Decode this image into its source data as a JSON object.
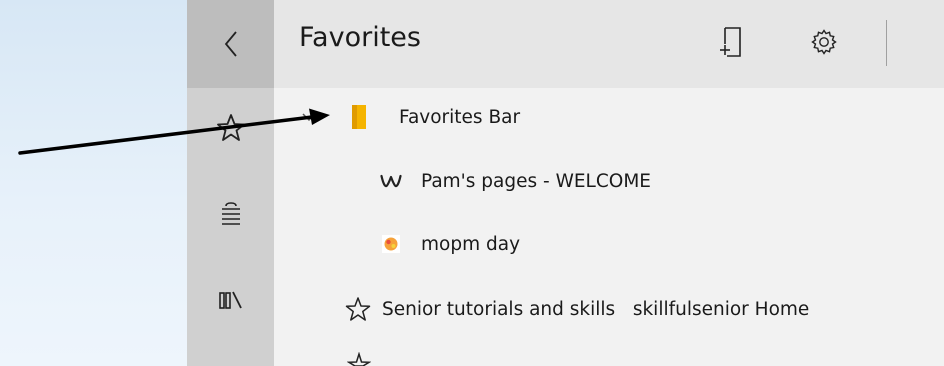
{
  "panel": {
    "title": "Favorites",
    "icons": {
      "add_page": "add-page-icon",
      "settings": "gear-icon"
    }
  },
  "rail": {
    "items": [
      {
        "icon": "back-chevron-icon"
      },
      {
        "icon": "star-icon"
      },
      {
        "icon": "reading-list-icon"
      },
      {
        "icon": "library-icon"
      }
    ]
  },
  "favorites": {
    "items": [
      {
        "label": "Favorites Bar",
        "icon": "folder-icon",
        "expanded": true
      },
      {
        "label": "Pam's pages - WELCOME",
        "icon": "weebly-icon"
      },
      {
        "label": "mopm day",
        "icon": "site-favicon"
      },
      {
        "label": "Senior tutorials and skills   skillfulsenior Home",
        "icon": "star-outline-icon"
      }
    ]
  },
  "colors": {
    "folder": "#f5b400",
    "rail": "#d0d0d0",
    "rail_active": "#bdbdbd",
    "header": "#e6e6e6",
    "panel": "#f2f2f2"
  }
}
